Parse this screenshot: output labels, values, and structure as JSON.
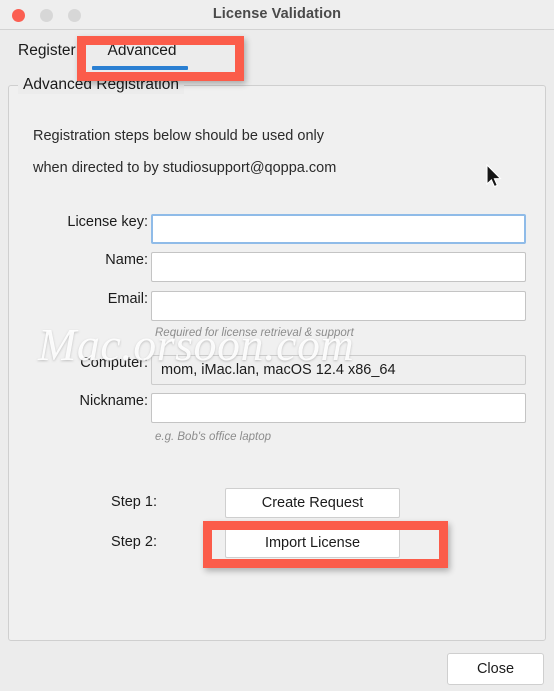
{
  "window": {
    "title": "License Validation",
    "controls": {
      "close": "close-button",
      "minimize": "minimize-button",
      "maximize": "maximize-button"
    },
    "colors": {
      "close_dot": "#fb5f52",
      "inactive_dot": "#d7d7d7",
      "tab_accent": "#2a7fd2",
      "annotation": "#fb5c4a",
      "focus_border": "#8fbbe8",
      "window_bg": "#ececec"
    }
  },
  "tabs": [
    {
      "label": "Register",
      "selected": false
    },
    {
      "label": "Advanced",
      "selected": true
    }
  ],
  "group": {
    "title": "Advanced Registration",
    "intro_line1": "Registration steps below should be used only",
    "intro_line2": "when directed to by studiosupport@qoppa.com"
  },
  "fields": [
    {
      "label": "License key:",
      "value": "",
      "placeholder": "",
      "focused": true,
      "readonly": false,
      "hint": ""
    },
    {
      "label": "Name:",
      "value": "",
      "placeholder": "",
      "focused": false,
      "readonly": false,
      "hint": ""
    },
    {
      "label": "Email:",
      "value": "",
      "placeholder": "",
      "focused": false,
      "readonly": false,
      "hint": "Required for license retrieval & support"
    },
    {
      "label": "Computer:",
      "value": "mom, iMac.lan, macOS 12.4 x86_64",
      "placeholder": "",
      "focused": false,
      "readonly": true,
      "hint": ""
    },
    {
      "label": "Nickname:",
      "value": "",
      "placeholder": "",
      "focused": false,
      "readonly": false,
      "hint": "e.g. Bob's office laptop"
    }
  ],
  "steps": [
    {
      "label": "Step 1:",
      "button": "Create Request",
      "highlighted": false
    },
    {
      "label": "Step 2:",
      "button": "Import License",
      "highlighted": true
    }
  ],
  "footer": {
    "close_label": "Close"
  },
  "overlay": {
    "watermark": "Mac.orsoon.com",
    "cursor": "arrow-cursor",
    "annotations": [
      "advanced-tab",
      "import-license-button"
    ]
  }
}
